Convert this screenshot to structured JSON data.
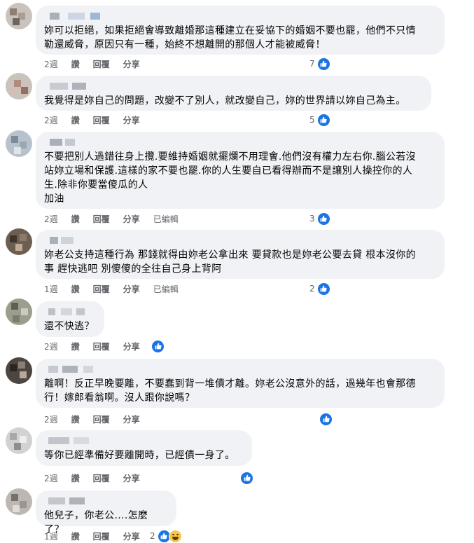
{
  "comments": [
    {
      "text": "妳可以拒絕，如果拒絕會導致離婚那這種建立在妥協下的婚姻不要也罷，他們不只情\n勒還威脅，原因只有一種，始終不想離開的那個人才能被威脅！",
      "time": "2週",
      "like_label": "讚",
      "reply_label": "回覆",
      "share_label": "分享",
      "edited_label": "",
      "reaction_count": "7",
      "reactions": [
        "like"
      ]
    },
    {
      "text": "我覺得是妳自己的問題，改變不了別人，就改變自己，妳的世界請以妳自己為主。",
      "time": "2週",
      "like_label": "讚",
      "reply_label": "回覆",
      "share_label": "分享",
      "edited_label": "",
      "reaction_count": "5",
      "reactions": [
        "like"
      ]
    },
    {
      "text": "不要把別人過錯往身上攬.要維持婚姻就擺爛不用理會.他們沒有權力左右你.腦公若沒\n站妳立場和保護.這樣的家不要也罷.你的人生要自已看得辦而不是讓別人操控你的人\n生.除非你要當傻瓜的人\n加油",
      "time": "2週",
      "like_label": "讚",
      "reply_label": "回覆",
      "share_label": "分享",
      "edited_label": "已編輯",
      "reaction_count": "3",
      "reactions": [
        "like"
      ]
    },
    {
      "text": "妳老公支持這種行為 那錢就得由妳老公拿出來 要貸款也是妳老公要去貸 根本沒你的\n事 趕快逃吧 別傻傻的全往自己身上背阿",
      "time": "1週",
      "like_label": "讚",
      "reply_label": "回覆",
      "share_label": "分享",
      "edited_label": "已編輯",
      "reaction_count": "2",
      "reactions": [
        "like"
      ]
    },
    {
      "text": "還不快逃？",
      "time": "2週",
      "like_label": "讚",
      "reply_label": "回覆",
      "share_label": "分享",
      "edited_label": "",
      "reaction_count": "",
      "reactions": [
        "like"
      ]
    },
    {
      "text": "離啊！反正早晚要離，不要蠢到背一堆債才離。妳老公沒意外的話，過幾年也會那德\n行！嫁郎看翁啊。沒人跟你說嗎？",
      "time": "2週",
      "like_label": "讚",
      "reply_label": "回覆",
      "share_label": "分享",
      "edited_label": "",
      "reaction_count": "",
      "reactions": [
        "like"
      ]
    },
    {
      "text": "等你已經準備好要離開時，已經債一身了。",
      "time": "2週",
      "like_label": "讚",
      "reply_label": "回覆",
      "share_label": "分享",
      "edited_label": "",
      "reaction_count": "",
      "reactions": [
        "like"
      ]
    },
    {
      "text": "他兒子，你老公....怎麼了？",
      "time": "1週",
      "like_label": "讚",
      "reply_label": "回覆",
      "share_label": "分享",
      "edited_label": "",
      "reaction_count": "2",
      "reactions": [
        "like",
        "haha"
      ]
    }
  ],
  "colors": {
    "bubble": "#f0f2f5",
    "meta": "#65676b",
    "like": "#1b74e4",
    "haha": "#f7c844"
  }
}
